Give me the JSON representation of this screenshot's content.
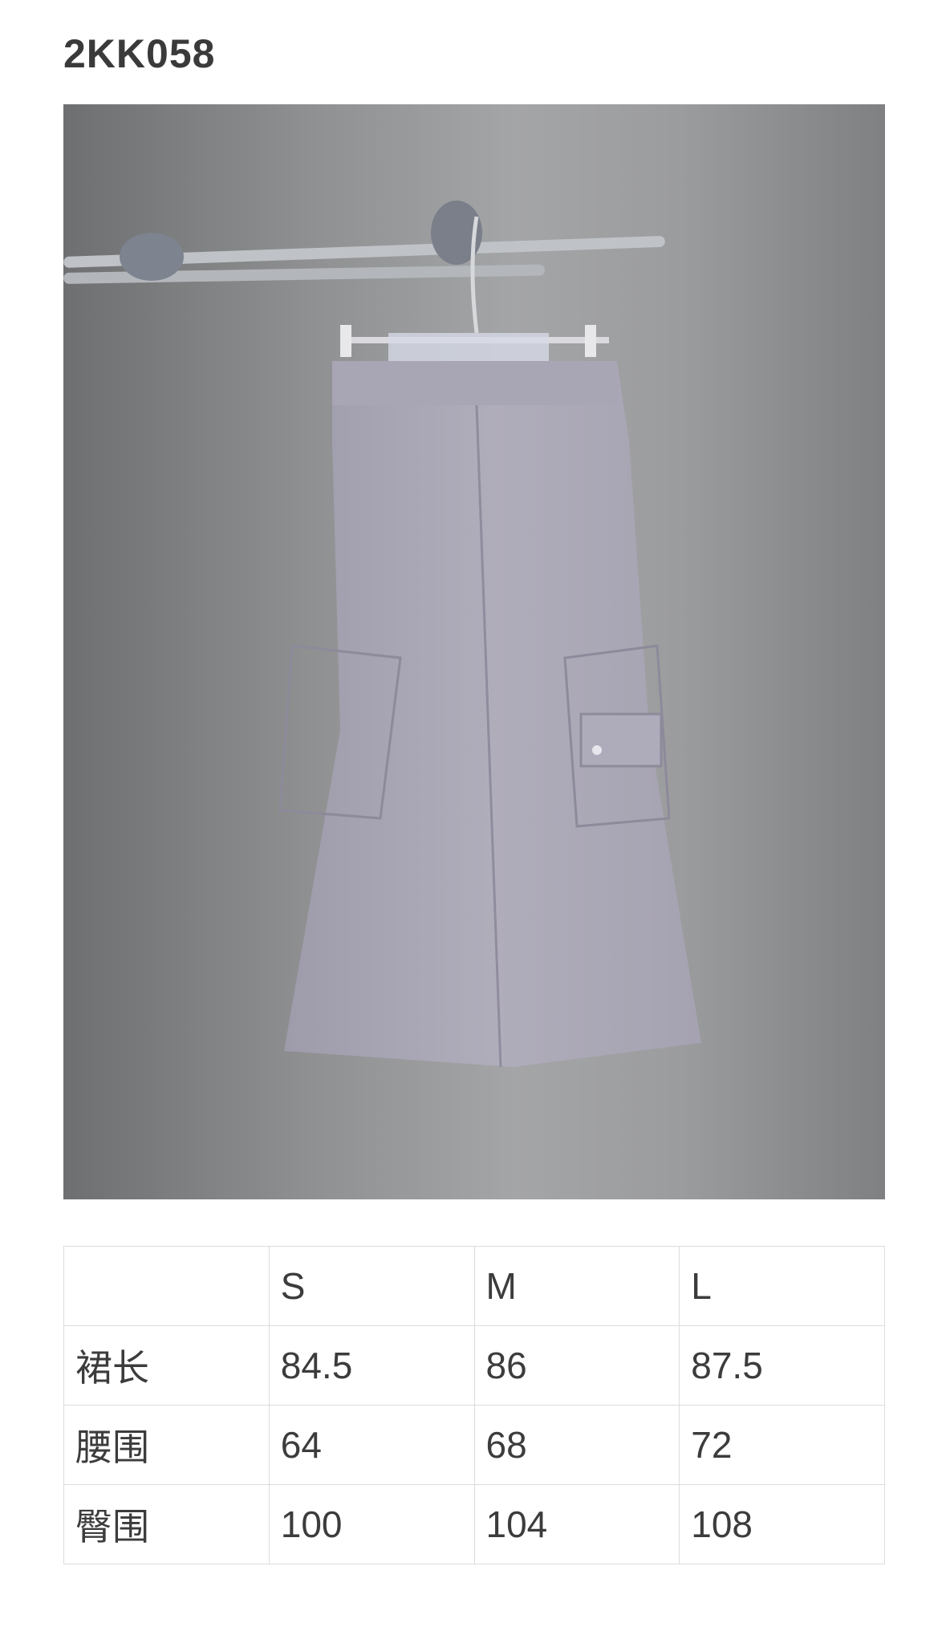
{
  "product": {
    "code": "2KK058"
  },
  "photo": {
    "subject": "skirt-photo",
    "background_color": "#8f9091",
    "garment_color": "#a9a6b4"
  },
  "size_table": {
    "header": [
      "",
      "S",
      "M",
      "L"
    ],
    "rows": [
      {
        "label": "裙长",
        "values": [
          "84.5",
          "86",
          "87.5"
        ]
      },
      {
        "label": "腰围",
        "values": [
          "64",
          "68",
          "72"
        ]
      },
      {
        "label": "臀围",
        "values": [
          "100",
          "104",
          "108"
        ]
      }
    ]
  }
}
